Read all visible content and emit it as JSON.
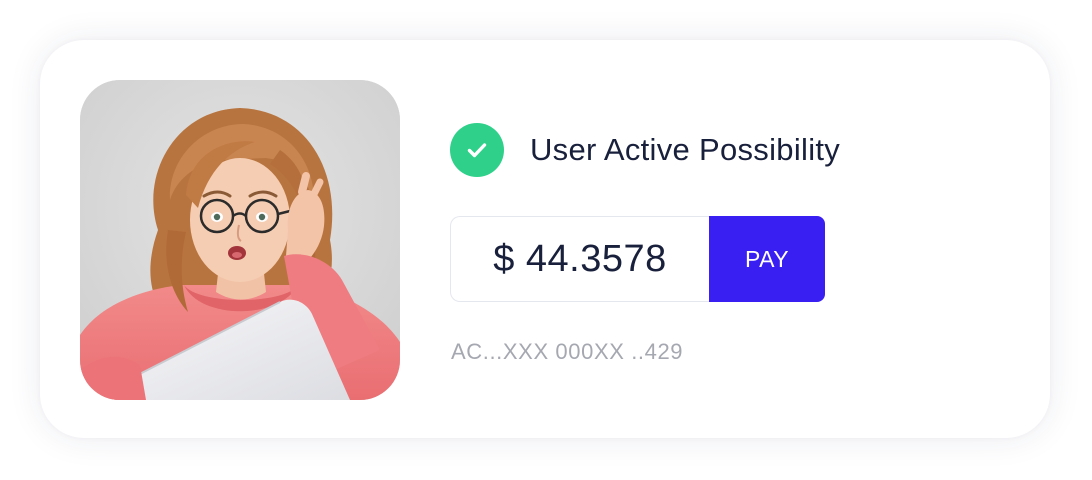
{
  "card": {
    "status": {
      "label": "User Active Possibility",
      "icon": "check-icon",
      "icon_color": "#2fd18a"
    },
    "amount": {
      "value": "$ 44.3578"
    },
    "pay_button": {
      "label": "PAY",
      "color": "#3a1ff2"
    },
    "account_number": "AC...XXX 000XX ..429",
    "avatar": {
      "icon": "user-photo"
    }
  }
}
